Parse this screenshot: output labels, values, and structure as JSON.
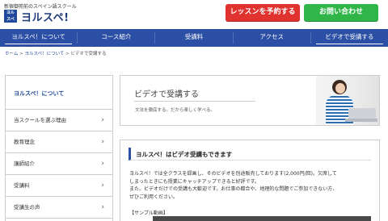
{
  "header": {
    "tagline": "新宿御苑前のスペイン語スクール",
    "logo_mark_top": "ヨル",
    "logo_mark_bottom": "スペ",
    "logo_text": "ヨルスペ!",
    "reserve_label": "レッスンを予約する",
    "contact_label": "お問い合わせ",
    "colors": {
      "reserve": "#e0322e",
      "contact": "#2fb548",
      "nav": "#2b4fa4"
    }
  },
  "nav": {
    "items": [
      {
        "label": "ヨルスペ！について"
      },
      {
        "label": "コース紹介"
      },
      {
        "label": "受講料"
      },
      {
        "label": "アクセス"
      },
      {
        "label": "ビデオで受講する"
      }
    ]
  },
  "breadcrumb": {
    "home": "ホーム",
    "sep": ">",
    "parent": "ヨルスペ！について",
    "current": "ビデオで受講する"
  },
  "sidebar": {
    "heading": "ヨルスペ！について",
    "items": [
      {
        "label": "当スクールを選ぶ理由",
        "icon": "chevron-right-icon"
      },
      {
        "label": "教育理念",
        "icon": "chevron-right-icon"
      },
      {
        "label": "講師紹介",
        "icon": "chevron-right-icon"
      },
      {
        "label": "受講料",
        "icon": "chevron-right-icon"
      },
      {
        "label": "受講生の声",
        "icon": "chevron-right-icon"
      }
    ]
  },
  "hero": {
    "title": "ビデオで受講する",
    "subtitle": "文法を徹底する。だから楽しく学べる。"
  },
  "section": {
    "title": "ヨルスペ！はビデオ受講もできます",
    "paragraph_lines": [
      "ヨルスペ！では全クラスを録画し、そのビデオを別途販売しております(2,000円/回)。欠席して",
      "しまったときにも授業にキャッチアップできると好評です。",
      "また、ビデオだけでの受講も大歓迎です。お仕事の都合や、地理的な問題でご参加できない方、",
      "ぜひご利用ください。"
    ],
    "sample_label": "【サンプル動画】"
  }
}
